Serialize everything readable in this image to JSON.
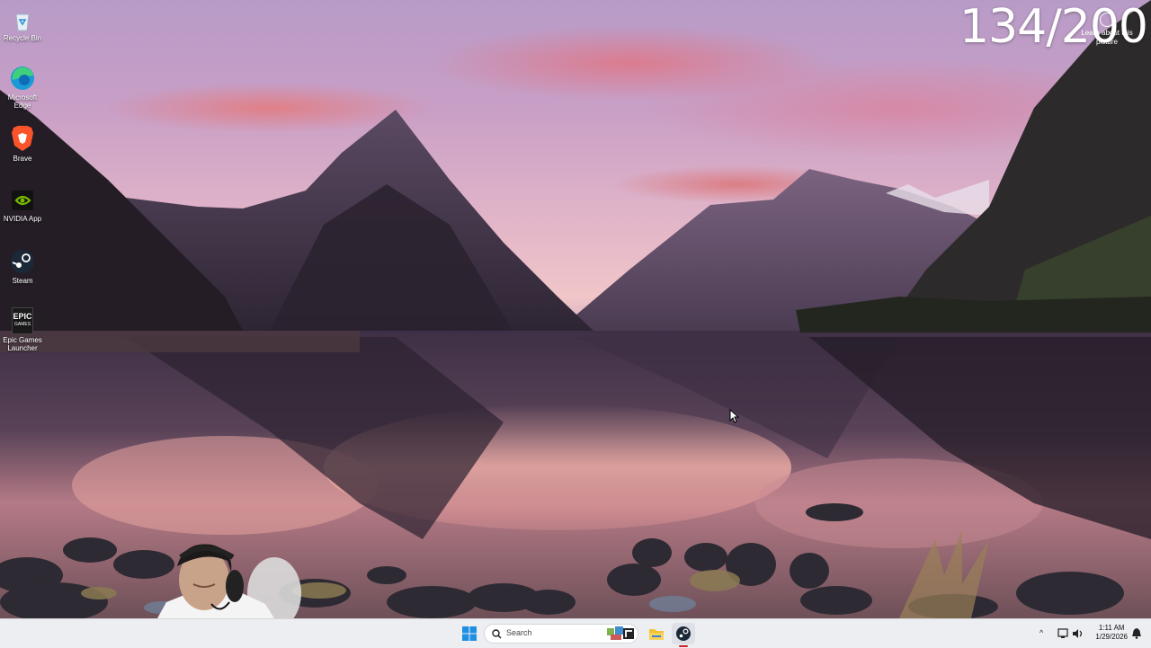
{
  "watermark": {
    "counter": "134/200"
  },
  "learn_about": {
    "label": "Learn about this picture"
  },
  "desktop_icons": [
    {
      "label": "Recycle Bin"
    },
    {
      "label": "Microsoft Edge"
    },
    {
      "label": "Brave"
    },
    {
      "label": "NVIDIA App"
    },
    {
      "label": "Steam"
    },
    {
      "label": "Epic Games Launcher"
    }
  ],
  "epic_logo": {
    "line1": "EPIC",
    "line2": "GAMES"
  },
  "taskbar": {
    "search_placeholder": "Search",
    "pinned": [
      "windows-start",
      "search",
      "widgets",
      "task-view",
      "file-explorer",
      "steam"
    ],
    "clock": {
      "time": "1:11 AM",
      "date": "1/29/2026"
    }
  },
  "colors": {
    "taskbar_bg": "#eceef2",
    "windows_blue": "#1e8fe1",
    "steam_dark": "#1b2838",
    "explorer_yellow": "#f2c232"
  }
}
